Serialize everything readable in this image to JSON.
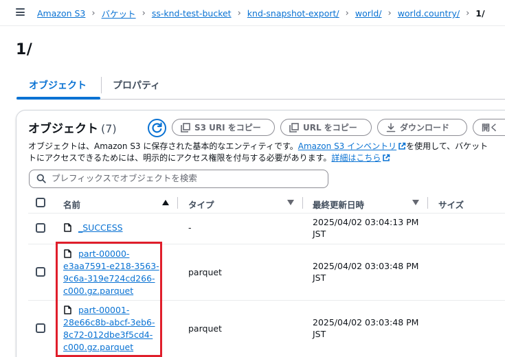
{
  "breadcrumb": {
    "items": [
      "Amazon S3",
      "バケット",
      "ss-knd-test-bucket",
      "knd-snapshot-export/",
      "world/",
      "world.country/"
    ],
    "current": "1/"
  },
  "page": {
    "title": "1/"
  },
  "tabs": [
    "オブジェクト",
    "プロパティ"
  ],
  "objects_panel": {
    "title": "オブジェクト",
    "count": "(7)",
    "buttons": {
      "copy_s3_uri": "S3 URI をコピー",
      "copy_url": "URL をコピー",
      "download": "ダウンロード",
      "open": "開く"
    },
    "description": {
      "part1": "オブジェクトは、Amazon S3 に保存された基本的なエンティティです。",
      "inventory_link": "Amazon S3 インベントリ",
      "part2": "を使用して、バケット",
      "part3": "トにアクセスできるためには、明示的にアクセス権限を付与する必要があります。",
      "details_link": "詳細はこちら"
    },
    "search": {
      "placeholder": "プレフィックスでオブジェクトを検索"
    },
    "columns": {
      "name": "名前",
      "type": "タイプ",
      "last_modified": "最終更新日時",
      "size": "サイズ"
    },
    "rows": [
      {
        "name_lines": [
          "_SUCCESS"
        ],
        "type": "-",
        "modified_lines": [
          "2025/04/02 03:04:13 PM",
          "JST"
        ]
      },
      {
        "name_lines": [
          "part-00000-",
          "e3aa7591-e218-3563-",
          "9c6a-319e724cd266-",
          "c000.gz.parquet"
        ],
        "type": "parquet",
        "modified_lines": [
          "2025/04/02 03:03:48 PM",
          "JST"
        ]
      },
      {
        "name_lines": [
          "part-00001-",
          "28e66c8b-abcf-3eb6-",
          "8c72-012dbe3f5cd4-",
          "c000.gz.parquet"
        ],
        "type": "parquet",
        "modified_lines": [
          "2025/04/02 03:03:48 PM",
          "JST"
        ]
      }
    ]
  },
  "colors": {
    "link": "#0972d3",
    "highlight": "#e01e2b",
    "text": "#0f141a"
  },
  "icons": [
    "hamburger-icon",
    "refresh-icon",
    "copy-icon",
    "download-icon",
    "external-link-icon",
    "search-icon",
    "file-icon",
    "sort-ascending-icon",
    "sort-descending-icon"
  ]
}
